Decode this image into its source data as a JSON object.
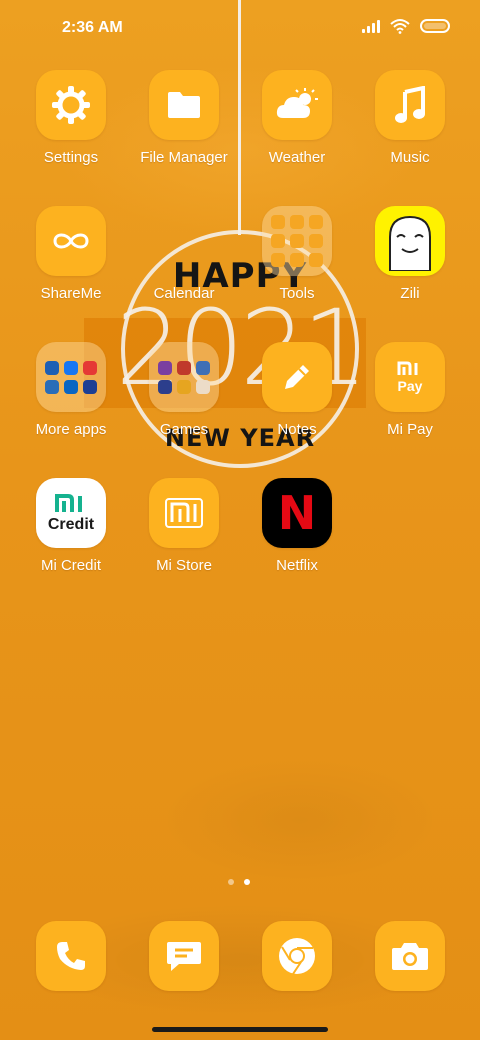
{
  "status_bar": {
    "time": "2:36 AM"
  },
  "wallpaper": {
    "happy": "HAPPY",
    "year": "2021",
    "new_year": "NEW YEAR"
  },
  "apps": {
    "settings": {
      "label": "Settings",
      "icon": "gear-icon"
    },
    "file_manager": {
      "label": "File Manager",
      "icon": "folder-icon"
    },
    "weather": {
      "label": "Weather",
      "icon": "cloud-sun-icon"
    },
    "music": {
      "label": "Music",
      "icon": "music-note-icon"
    },
    "shareme": {
      "label": "ShareMe",
      "icon": "infinity-icon"
    },
    "calendar": {
      "label": "Calendar"
    },
    "tools": {
      "label": "Tools"
    },
    "zili": {
      "label": "Zili",
      "icon": "ghost-face-icon"
    },
    "more_apps": {
      "label": "More apps"
    },
    "games": {
      "label": "Games"
    },
    "notes": {
      "label": "Notes",
      "icon": "pencil-icon"
    },
    "mi_pay": {
      "label": "Mi Pay",
      "logo_text": "Pay"
    },
    "mi_credit": {
      "label": "Mi Credit",
      "logo_text": "Credit"
    },
    "mi_store": {
      "label": "Mi Store",
      "icon": "mi-logo-icon"
    },
    "netflix": {
      "label": "Netflix",
      "logo_text": "N"
    }
  },
  "dock": [
    {
      "icon": "phone-icon"
    },
    {
      "icon": "message-icon"
    },
    {
      "icon": "chrome-icon"
    },
    {
      "icon": "camera-icon"
    }
  ],
  "pages": {
    "count": 2,
    "active": 2
  },
  "colors": {
    "background": "#ea9418",
    "tile": "#fdb21f",
    "text": "#ffffff",
    "netflix_red": "#e50914",
    "mi_credit_green": "#15b28f"
  }
}
